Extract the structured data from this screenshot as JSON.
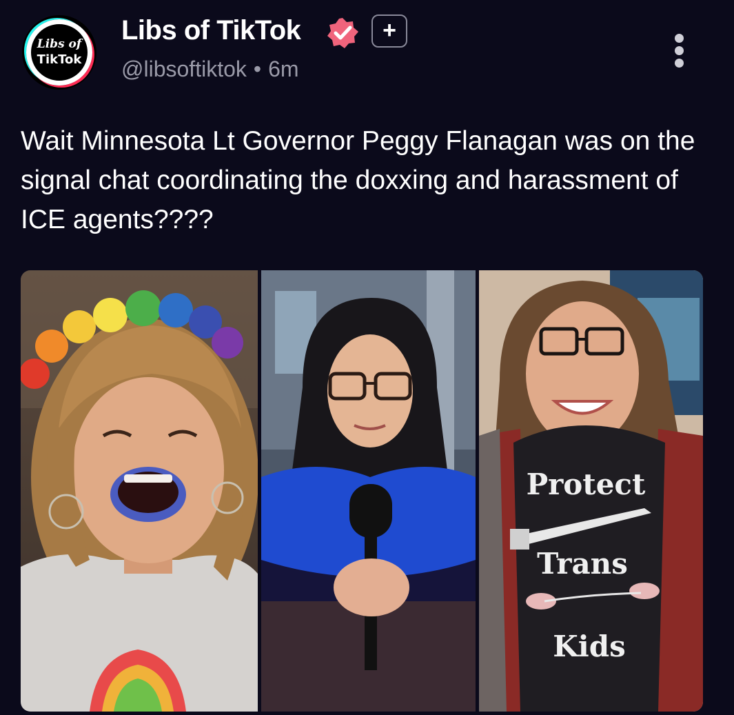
{
  "post": {
    "avatar_text_line1": "Libs of",
    "avatar_text_line2": "TikTok",
    "display_name": "Libs of TikTok",
    "handle": "@libsoftiktok",
    "separator": "•",
    "time_ago": "6m",
    "text": "Wait Minnesota Lt Governor Peggy Flanagan was on the signal chat coordinating the doxxing and harassment of ICE agents????",
    "icons": {
      "verified": "verified-badge-icon",
      "add": "plus-icon",
      "more": "more-vertical-icon"
    },
    "colors": {
      "background": "#0b0a1b",
      "verified_badge": "#f0647c",
      "handle_text": "#9a9aa8"
    }
  },
  "media": {
    "panels": [
      {
        "subject": "woman-laughing-rainbow-pompom-headband"
      },
      {
        "subject": "woman-in-black-hood-holding-microphone"
      },
      {
        "subject": "woman-in-protect-trans-kids-shirt"
      }
    ],
    "shirt_text": {
      "line1": "Protect",
      "line2": "Trans",
      "line3": "Kids"
    }
  }
}
